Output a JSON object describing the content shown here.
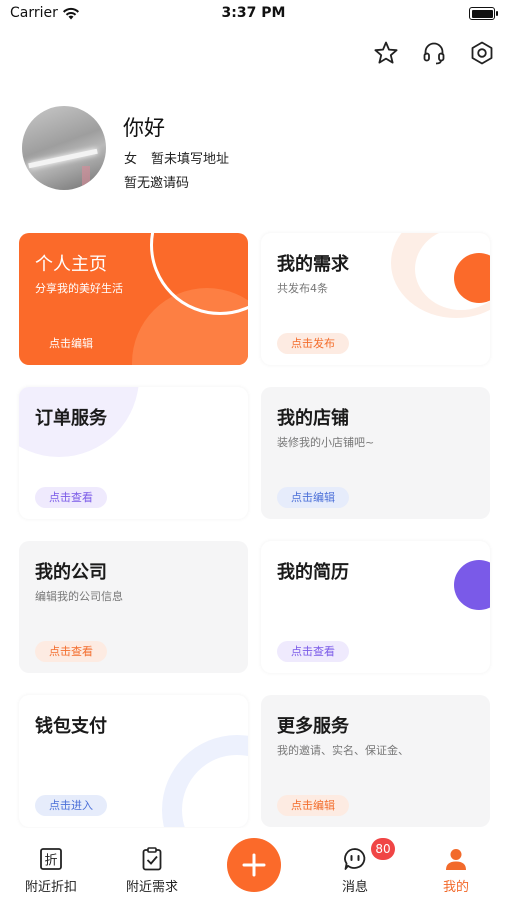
{
  "status_bar": {
    "carrier": "Carrier",
    "time": "3:37 PM"
  },
  "header_icons": [
    "star-icon",
    "headset-icon",
    "hexagon-settings-icon"
  ],
  "profile": {
    "greeting": "你好",
    "gender": "女",
    "address": "暂未填写地址",
    "invite_code": "暂无邀请码"
  },
  "cards": [
    {
      "title": "个人主页",
      "subtitle": "分享我的美好生活",
      "action": "点击编辑",
      "color": "#fb6a2a"
    },
    {
      "title": "我的需求",
      "subtitle": "共发布4条",
      "action": "点击发布",
      "color": "#f36d2c"
    },
    {
      "title": "订单服务",
      "subtitle": "",
      "action": "点击查看",
      "color": "#7a5ae8"
    },
    {
      "title": "我的店铺",
      "subtitle": "装修我的小店铺吧~",
      "action": "点击编辑",
      "color": "#4b6fd8"
    },
    {
      "title": "我的公司",
      "subtitle": "编辑我的公司信息",
      "action": "点击查看",
      "color": "#f36d2c"
    },
    {
      "title": "我的简历",
      "subtitle": "",
      "action": "点击查看",
      "color": "#7a5ae8"
    },
    {
      "title": "钱包支付",
      "subtitle": "",
      "action": "点击进入",
      "color": "#4b6fd8"
    },
    {
      "title": "更多服务",
      "subtitle": "我的邀请、实名、保证金、",
      "action": "点击编辑",
      "color": "#f36d2c"
    }
  ],
  "tabbar": {
    "tabs": [
      {
        "label": "附近折扣",
        "icon": "discount-icon"
      },
      {
        "label": "附近需求",
        "icon": "clipboard-check-icon"
      },
      {
        "label": "消息",
        "icon": "message-icon",
        "badge": "80"
      },
      {
        "label": "我的",
        "icon": "user-icon",
        "active": true
      }
    ],
    "center_button_icon": "plus-icon",
    "accent": "#f26a2b"
  }
}
